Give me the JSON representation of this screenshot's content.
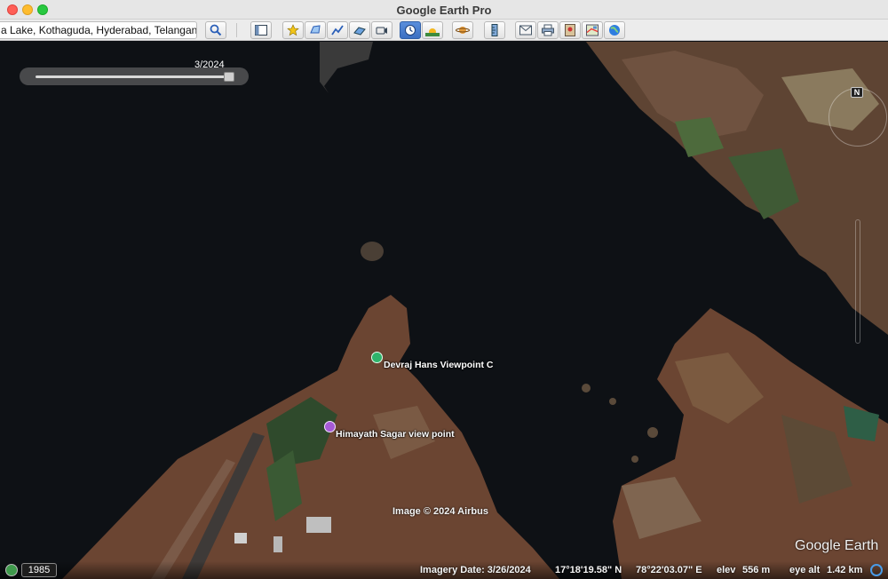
{
  "window": {
    "title": "Google Earth Pro"
  },
  "toolbar": {
    "search_value": "a Lake, Kothaguda, Hyderabad, Telangana",
    "buttons": [
      {
        "name": "search-button",
        "icon": "magnifier-icon"
      },
      {
        "name": "sidebar-toggle-button",
        "icon": "sidebar-icon"
      },
      {
        "name": "add-placemark-button",
        "icon": "pushpin-icon"
      },
      {
        "name": "add-polygon-button",
        "icon": "polygon-icon"
      },
      {
        "name": "add-path-button",
        "icon": "path-icon"
      },
      {
        "name": "add-overlay-button",
        "icon": "image-overlay-icon"
      },
      {
        "name": "record-tour-button",
        "icon": "tour-icon"
      },
      {
        "name": "historical-imagery-button",
        "icon": "clock-icon",
        "active": true
      },
      {
        "name": "sunlight-button",
        "icon": "sun-icon"
      },
      {
        "name": "planets-button",
        "icon": "planet-icon"
      },
      {
        "name": "ruler-button",
        "icon": "ruler-icon"
      },
      {
        "name": "email-button",
        "icon": "envelope-icon"
      },
      {
        "name": "print-button",
        "icon": "printer-icon"
      },
      {
        "name": "save-image-button",
        "icon": "camera-icon"
      },
      {
        "name": "maps-button",
        "icon": "map-icon"
      },
      {
        "name": "earth-view-button",
        "icon": "globe-icon"
      }
    ]
  },
  "time_slider": {
    "date": "3/2024",
    "position": 1.0
  },
  "placemarks": [
    {
      "label": "Devraj Hans Viewpoint C",
      "color": "#2fb36b",
      "icon": "pin-icon"
    },
    {
      "label": "Himayath Sagar view point",
      "color": "#a65ad6",
      "icon": "camera-pin-icon"
    }
  ],
  "map": {
    "copyright": "Image © 2024 Airbus",
    "logo": "Google Earth",
    "compass_label": "N"
  },
  "status_bar": {
    "year": "1985",
    "imagery_date": "Imagery Date: 3/26/2024",
    "lat": "17°18'19.58\" N",
    "lon": "78°22'03.07\" E",
    "elev_label": "elev",
    "elev_value": "556 m",
    "eye_alt_label": "eye alt",
    "eye_alt_value": "1.42 km"
  },
  "colors": {
    "water": "#0d1014",
    "land": "#6b4a3a",
    "accent": "#3b6fc2"
  }
}
